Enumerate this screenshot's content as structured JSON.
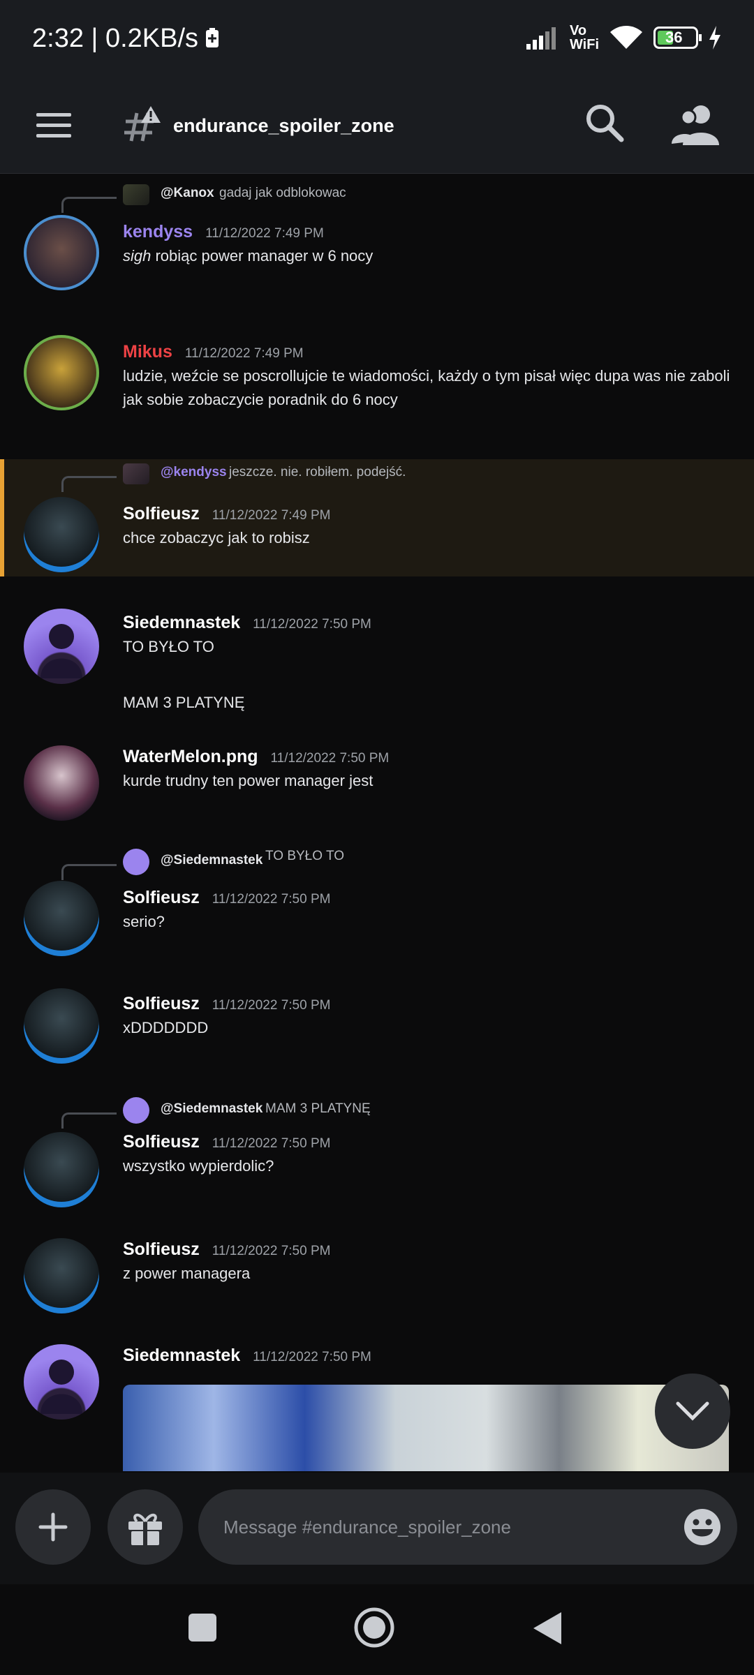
{
  "status_bar": {
    "time_speed": "2:32 | 0.2KB/s",
    "battery": "36",
    "vowifi": "Vo\nWiFi"
  },
  "header": {
    "channel": "endurance_spoiler_zone"
  },
  "messages": [
    {
      "user": "kendyss",
      "user_color": "#9b84ee",
      "time": "11/12/2022 7:49 PM",
      "reply_to": {
        "name": "@Kanox",
        "text": "gadaj jak odblokowac"
      },
      "text_em": "sigh",
      "text": " robiąc power manager w 6 nocy"
    },
    {
      "user": "Mikus",
      "user_color": "#ed4245",
      "time": "11/12/2022 7:49 PM",
      "text": "ludzie, weźcie se poscrollujcie te wiadomości, każdy o tym pisał więc dupa was nie zaboli jak sobie zobaczycie poradnik do 6 nocy"
    },
    {
      "user": "Solfieusz",
      "time": "11/12/2022 7:49 PM",
      "reply_to": {
        "name": "@kendyss",
        "text": "jeszcze. nie. robiłem. podejść."
      },
      "text": "chce zobaczyc jak to robisz"
    },
    {
      "user": "Siedemnastek",
      "time": "11/12/2022 7:50 PM",
      "text": "TO BYŁO TO",
      "text2": "MAM 3 PLATYNĘ"
    },
    {
      "user": "WaterMelon.png",
      "time": "11/12/2022 7:50 PM",
      "text": "kurde trudny ten power manager jest"
    },
    {
      "user": "Solfieusz",
      "time": "11/12/2022 7:50 PM",
      "reply_to": {
        "name": "@Siedemnastek",
        "text": "TO BYŁO TO"
      },
      "text": "serio?"
    },
    {
      "user": "Solfieusz",
      "time": "11/12/2022 7:50 PM",
      "text": "xDDDDDDD"
    },
    {
      "user": "Solfieusz",
      "time": "11/12/2022 7:50 PM",
      "reply_to": {
        "name": "@Siedemnastek",
        "text": "MAM 3 PLATYNĘ"
      },
      "text": "wszystko wypierdolic?"
    },
    {
      "user": "Solfieusz",
      "time": "11/12/2022 7:50 PM",
      "text": "z power managera"
    },
    {
      "user": "Siedemnastek",
      "time": "11/12/2022 7:50 PM"
    }
  ],
  "input": {
    "placeholder": "Message #endurance_spoiler_zone"
  },
  "colors": {
    "accent_highlight": "#e8a234",
    "background": "#0b0b0c",
    "bar": "#1a1c20"
  }
}
